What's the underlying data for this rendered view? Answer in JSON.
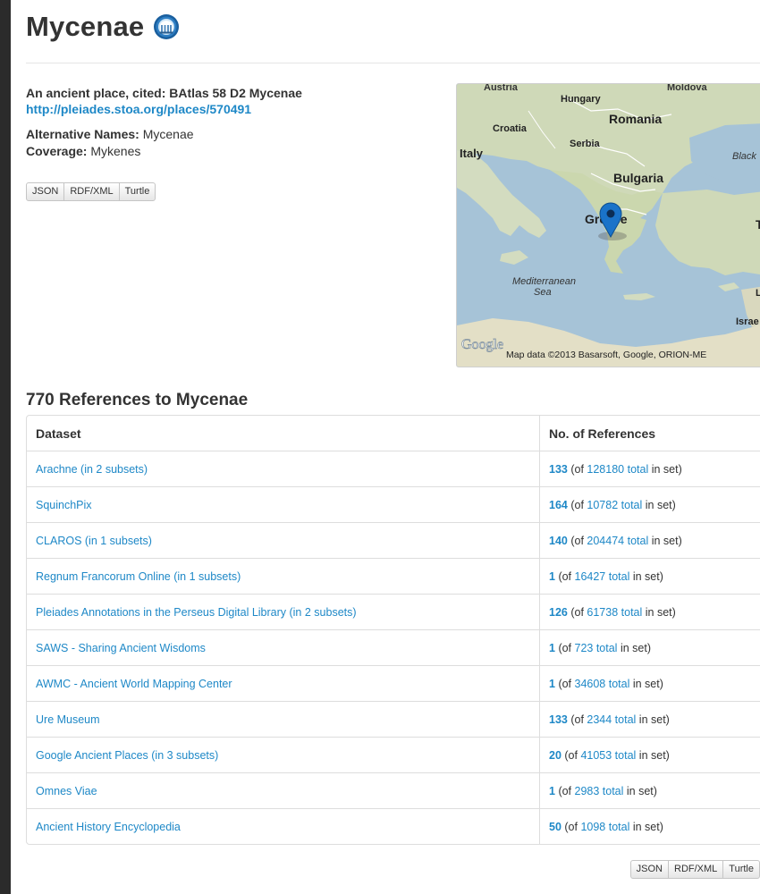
{
  "place": {
    "title": "Mycenae",
    "cited": "An ancient place, cited: BAtlas 58 D2 Mycenae",
    "uri": "http://pleiades.stoa.org/places/570491",
    "alt_names_label": "Alternative Names:",
    "alt_names_value": "Mycenae",
    "coverage_label": "Coverage:",
    "coverage_value": "Mykenes"
  },
  "formats": [
    "JSON",
    "RDF/XML",
    "Turtle"
  ],
  "map": {
    "labels": {
      "austria": "Austria",
      "moldova": "Moldova",
      "hungary": "Hungary",
      "romania": "Romania",
      "croatia": "Croatia",
      "serbia": "Serbia",
      "italy": "Italy",
      "black": "Black",
      "bulgaria": "Bulgaria",
      "greece": "Greece",
      "tu": "Tu",
      "mediterranean": "Mediterranean",
      "sea": "Sea",
      "le": "Le",
      "israel": "Israe"
    },
    "logo": "Google",
    "attribution": "Map data ©2013 Basarsoft, Google, ORION-ME",
    "marker": "map-pin",
    "marker_color": "#1a73c9"
  },
  "references": {
    "heading": "770 References to Mycenae",
    "col_dataset": "Dataset",
    "col_refs": "No. of References",
    "rows": [
      {
        "dataset": "Arachne (in 2 subsets)",
        "count": "133",
        "of": "(of ",
        "total": "128180 total",
        "suffix": " in set)"
      },
      {
        "dataset": "SquinchPix",
        "count": "164",
        "of": "(of ",
        "total": "10782 total",
        "suffix": " in set)"
      },
      {
        "dataset": "CLAROS (in 1 subsets)",
        "count": "140",
        "of": "(of ",
        "total": "204474 total",
        "suffix": " in set)"
      },
      {
        "dataset": "Regnum Francorum Online (in 1 subsets)",
        "count": "1",
        "of": "(of ",
        "total": "16427 total",
        "suffix": " in set)"
      },
      {
        "dataset": "Pleiades Annotations in the Perseus Digital Library (in 2 subsets)",
        "count": "126",
        "of": "(of ",
        "total": "61738 total",
        "suffix": " in set)"
      },
      {
        "dataset": "SAWS - Sharing Ancient Wisdoms",
        "count": "1",
        "of": "(of ",
        "total": "723 total",
        "suffix": " in set)"
      },
      {
        "dataset": "AWMC - Ancient World Mapping Center",
        "count": "1",
        "of": "(of ",
        "total": "34608 total",
        "suffix": " in set)"
      },
      {
        "dataset": "Ure Museum",
        "count": "133",
        "of": "(of ",
        "total": "2344 total",
        "suffix": " in set)"
      },
      {
        "dataset": "Google Ancient Places (in 3 subsets)",
        "count": "20",
        "of": "(of ",
        "total": "41053 total",
        "suffix": " in set)"
      },
      {
        "dataset": "Omnes Viae",
        "count": "1",
        "of": "(of ",
        "total": "2983 total",
        "suffix": " in set)"
      },
      {
        "dataset": "Ancient History Encyclopedia",
        "count": "50",
        "of": "(of ",
        "total": "1098 total",
        "suffix": " in set)"
      }
    ]
  },
  "colors": {
    "link": "#1e88c7",
    "text": "#333333",
    "border": "#dddddd"
  }
}
